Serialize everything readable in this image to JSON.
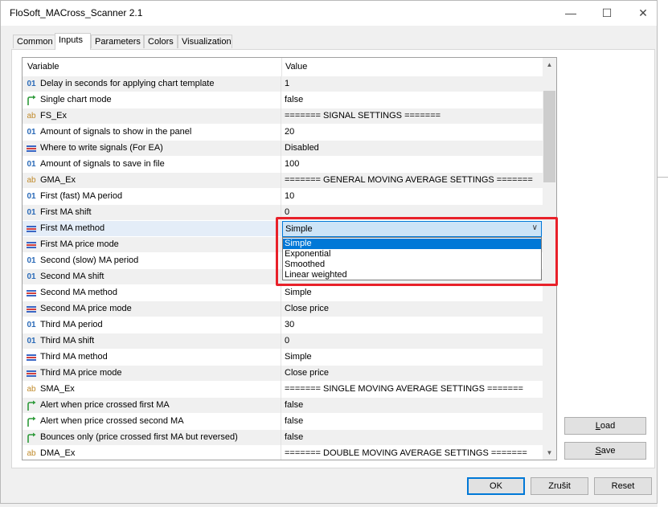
{
  "window": {
    "title": "FloSoft_MACross_Scanner 2.1",
    "minimize": "—",
    "maximize": "☐",
    "close": "✕"
  },
  "tabs": [
    {
      "label": "Common",
      "active": false
    },
    {
      "label": "Inputs",
      "active": true
    },
    {
      "label": "Parameters",
      "active": false
    },
    {
      "label": "Colors",
      "active": false
    },
    {
      "label": "Visualization",
      "active": false
    }
  ],
  "grid": {
    "col_variable": "Variable",
    "col_value": "Value",
    "rows": [
      {
        "type": "int",
        "icon": "01",
        "variable": "Delay in seconds for applying chart template",
        "value": "1"
      },
      {
        "type": "bool",
        "icon": "",
        "variable": "Single chart mode",
        "value": "false"
      },
      {
        "type": "string",
        "icon": "ab",
        "variable": "FS_Ex",
        "value": "======= SIGNAL SETTINGS ======="
      },
      {
        "type": "int",
        "icon": "01",
        "variable": "Amount of signals to show in the panel",
        "value": "20"
      },
      {
        "type": "enum",
        "icon": "",
        "variable": "Where to write signals (For EA)",
        "value": "Disabled"
      },
      {
        "type": "int",
        "icon": "01",
        "variable": "Amount of signals to save in file",
        "value": "100"
      },
      {
        "type": "string",
        "icon": "ab",
        "variable": "GMA_Ex",
        "value": "======= GENERAL MOVING AVERAGE SETTINGS ======="
      },
      {
        "type": "int",
        "icon": "01",
        "variable": "First (fast) MA period",
        "value": "10"
      },
      {
        "type": "int",
        "icon": "01",
        "variable": "First MA shift",
        "value": "0"
      },
      {
        "type": "enum",
        "icon": "",
        "variable": "First MA method",
        "value": ""
      },
      {
        "type": "enum",
        "icon": "",
        "variable": "First MA price mode",
        "value": ""
      },
      {
        "type": "int",
        "icon": "01",
        "variable": "Second (slow) MA period",
        "value": ""
      },
      {
        "type": "int",
        "icon": "01",
        "variable": "Second MA shift",
        "value": ""
      },
      {
        "type": "enum",
        "icon": "",
        "variable": "Second MA method",
        "value": "Simple"
      },
      {
        "type": "enum",
        "icon": "",
        "variable": "Second MA price mode",
        "value": "Close price"
      },
      {
        "type": "int",
        "icon": "01",
        "variable": "Third MA period",
        "value": "30"
      },
      {
        "type": "int",
        "icon": "01",
        "variable": "Third MA shift",
        "value": "0"
      },
      {
        "type": "enum",
        "icon": "",
        "variable": "Third MA method",
        "value": "Simple"
      },
      {
        "type": "enum",
        "icon": "",
        "variable": "Third MA price mode",
        "value": "Close price"
      },
      {
        "type": "string",
        "icon": "ab",
        "variable": "SMA_Ex",
        "value": "======= SINGLE MOVING AVERAGE SETTINGS ======="
      },
      {
        "type": "bool",
        "icon": "",
        "variable": "Alert when price crossed first MA",
        "value": "false"
      },
      {
        "type": "bool",
        "icon": "",
        "variable": "Alert when price crossed second MA",
        "value": "false"
      },
      {
        "type": "bool",
        "icon": "",
        "variable": "Bounces only (price crossed first MA but reversed)",
        "value": "false"
      },
      {
        "type": "string",
        "icon": "ab",
        "variable": "DMA_Ex",
        "value": "======= DOUBLE MOVING AVERAGE SETTINGS ======="
      }
    ]
  },
  "combo": {
    "selected": "Simple",
    "options": [
      "Simple",
      "Exponential",
      "Smoothed",
      "Linear weighted"
    ]
  },
  "buttons": {
    "load_prefix": "L",
    "load_rest": "oad",
    "save_prefix": "S",
    "save_rest": "ave",
    "ok": "OK",
    "cancel": "Zrušit",
    "reset": "Reset"
  },
  "colors": {
    "accent": "#0078d7",
    "highlight_box": "#e8212a",
    "int_icon": "#2a6ab8",
    "string_icon": "#c08a2a",
    "bool_icon": "#2e9a3a"
  }
}
